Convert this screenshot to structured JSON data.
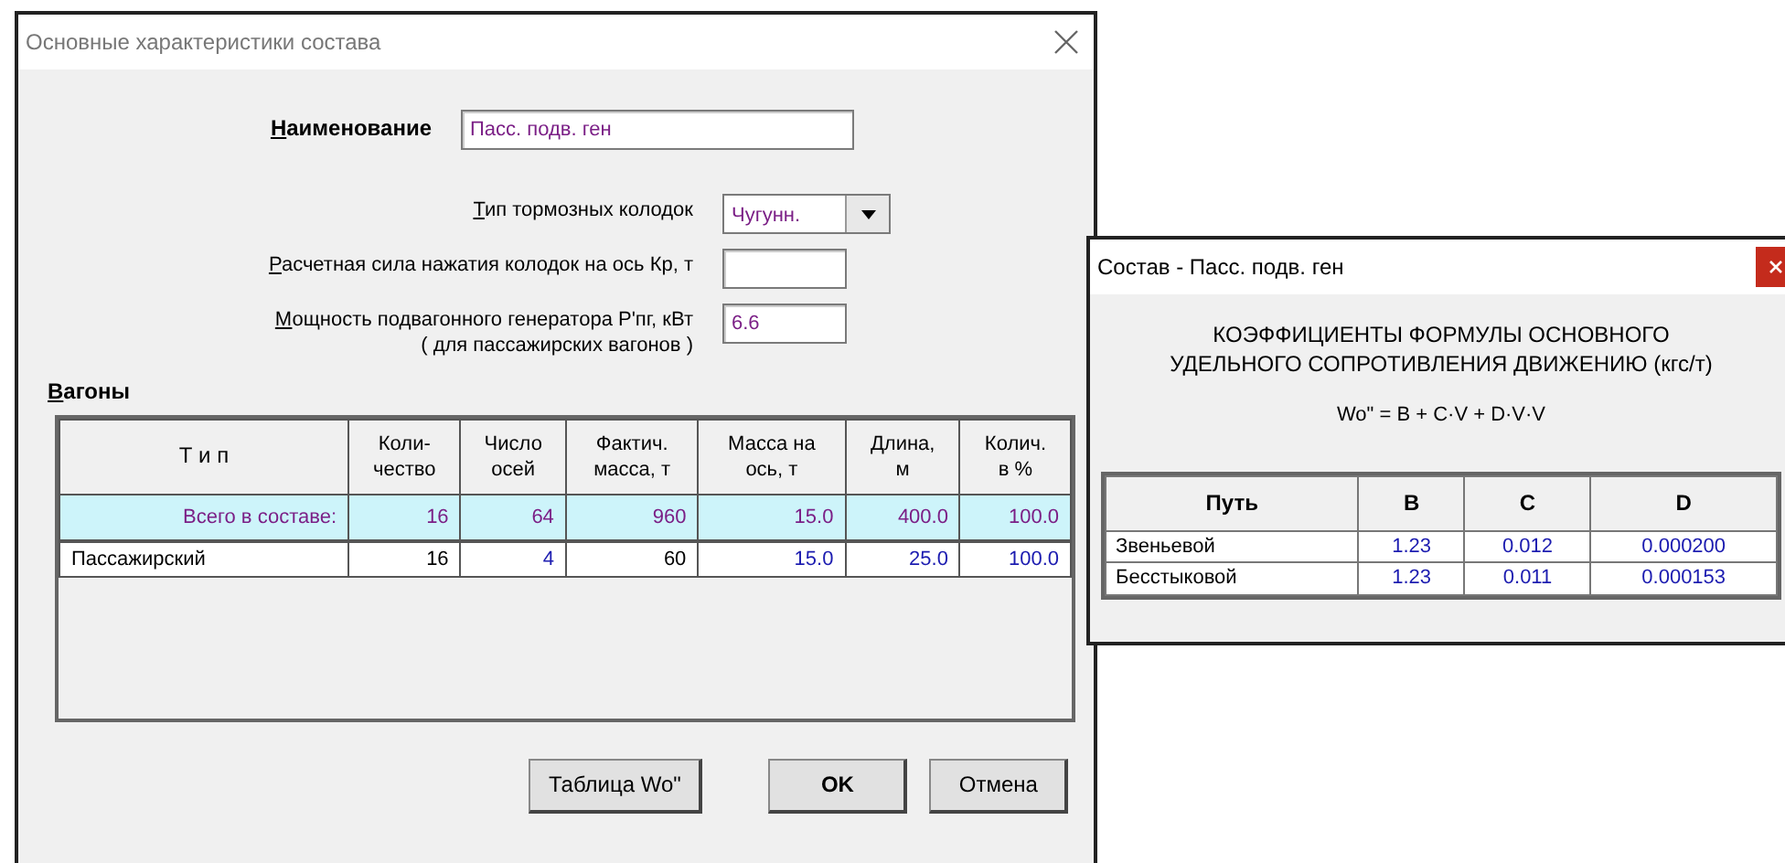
{
  "main_dialog": {
    "title": "Основные характеристики состава",
    "fields": [
      {
        "kind": "text",
        "label": "Наименование",
        "bold": true,
        "value": "Пасс. подв. ген"
      },
      {
        "kind": "select",
        "label": "Тип тормозных колодок",
        "value": "Чугунн."
      },
      {
        "kind": "number",
        "label": "Расчетная сила нажатия колодок на ось  Кр, т"
      },
      {
        "kind": "number",
        "label": "Мощность подвагонного генератора  P'пг, кВт",
        "note": "( для пассажирских вагонов )",
        "value": "6.6"
      }
    ],
    "wagons": {
      "title": "Вагоны",
      "columns": [
        "Т и п",
        "Коли-\nчество",
        "Число\nосей",
        "Фактич.\nмасса, т",
        "Масса на\nось, т",
        "Длина,\nм",
        "Колич.\nв  %"
      ],
      "rows": [
        {
          "kind": "total",
          "cells": [
            {
              "text": "Всего в составе:",
              "color": "#7b1f86"
            },
            {
              "text": "16",
              "color": "#7b1f86"
            },
            {
              "text": "64",
              "color": "#7b1f86"
            },
            {
              "text": "960",
              "color": "#7b1f86"
            },
            {
              "text": "15.0",
              "color": "#7b1f86"
            },
            {
              "text": "400.0",
              "color": "#7b1f86"
            },
            {
              "text": "100.0",
              "color": "#7b1f86"
            }
          ]
        },
        {
          "kind": "wagon",
          "cells": [
            {
              "text": "Пассажирский",
              "color": "#000000"
            },
            {
              "text": "16",
              "color": "#000000"
            },
            {
              "text": "4",
              "color": "#1c1cb0"
            },
            {
              "text": "60",
              "color": "#000000"
            },
            {
              "text": "15.0",
              "color": "#1c1cb0"
            },
            {
              "text": "25.0",
              "color": "#1c1cb0"
            },
            {
              "text": "100.0",
              "color": "#1c1cb0"
            }
          ]
        }
      ]
    },
    "buttons": [
      {
        "label": "Таблица Wo\"",
        "default": false
      },
      {
        "label": "OK",
        "default": true
      },
      {
        "label": "Отмена",
        "default": false
      }
    ]
  },
  "coef_window": {
    "title": "Состав - Пасс. подв. ген",
    "heading_lines": [
      "КОЭФФИЦИЕНТЫ ФОРМУЛЫ ОСНОВНОГО",
      "УДЕЛЬНОГО СОПРОТИВЛЕНИЯ ДВИЖЕНИЮ  (кгс/т)"
    ],
    "formula": "Wo\" = B + C·V + D·V·V",
    "columns": [
      "Путь",
      "B",
      "C",
      "D"
    ],
    "rows": [
      [
        "Звеньевой",
        "1.23",
        "0.012",
        "0.000200"
      ],
      [
        "Бесстыковой",
        "1.23",
        "0.011",
        "0.000153"
      ]
    ]
  }
}
